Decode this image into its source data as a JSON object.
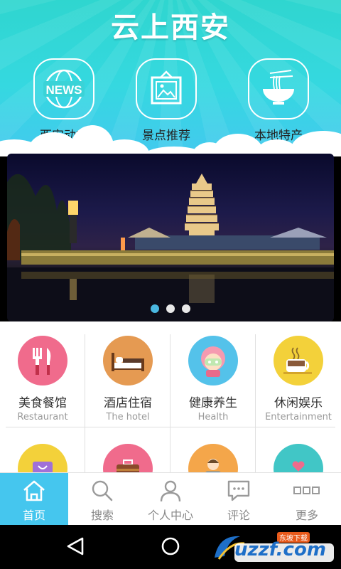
{
  "app": {
    "title": "云上西安"
  },
  "features": [
    {
      "label": "西安动态",
      "icon": "news-globe-icon",
      "icon_text": "NEWS"
    },
    {
      "label": "景点推荐",
      "icon": "picture-frame-icon"
    },
    {
      "label": "本地特产",
      "icon": "noodle-bowl-icon"
    }
  ],
  "banner": {
    "slide_count": 3,
    "active_index": 0
  },
  "categories": [
    {
      "cn": "美食餐馆",
      "en": "Restaurant",
      "icon": "fork-knife-icon",
      "color": "#f06b8c"
    },
    {
      "cn": "酒店住宿",
      "en": "The hotel",
      "icon": "bed-icon",
      "color": "#e59a52"
    },
    {
      "cn": "健康养生",
      "en": "Health",
      "icon": "face-mask-icon",
      "color": "#54c2ea"
    },
    {
      "cn": "休闲娱乐",
      "en": "Entertainment",
      "icon": "coffee-cup-icon",
      "color": "#f3d13a"
    },
    {
      "cn": "",
      "en": "",
      "icon": "shopping-bag-icon",
      "color": "#f3d13a"
    },
    {
      "cn": "",
      "en": "",
      "icon": "briefcase-icon",
      "color": "#f06b8c"
    },
    {
      "cn": "",
      "en": "",
      "icon": "person-icon",
      "color": "#f4a64a"
    },
    {
      "cn": "",
      "en": "",
      "icon": "heart-hands-icon",
      "color": "#41c6c6"
    }
  ],
  "nav": [
    {
      "label": "首页",
      "icon": "home-icon",
      "active": true
    },
    {
      "label": "搜索",
      "icon": "search-icon",
      "active": false
    },
    {
      "label": "个人中心",
      "icon": "user-icon",
      "active": false
    },
    {
      "label": "评论",
      "icon": "comment-icon",
      "active": false
    },
    {
      "label": "更多",
      "icon": "more-icon",
      "active": false
    }
  ],
  "system": {
    "back": "back-icon",
    "home": "home-circle-icon"
  },
  "watermark": {
    "brand": "uzzf.com",
    "tag": "东坡下载"
  },
  "colors": {
    "accent": "#45c6ee",
    "header_top": "#2fd6cf",
    "header_bottom": "#43c9ef"
  }
}
